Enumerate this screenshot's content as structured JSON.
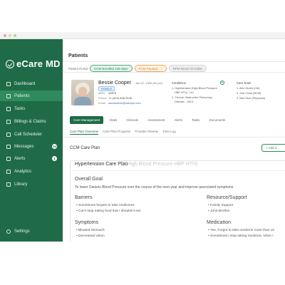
{
  "app": {
    "logo": "eCare MD",
    "colors": {
      "brand": "#1f6b47",
      "active_nav": "#2f8a5c"
    }
  },
  "sidebar": {
    "items": [
      {
        "label": "Dashboard",
        "icon": "grid-icon"
      },
      {
        "label": "Patients",
        "icon": "people-icon"
      },
      {
        "label": "Tasks",
        "icon": "checklist-icon"
      },
      {
        "label": "Billings & Claims",
        "icon": "dollar-icon"
      },
      {
        "label": "Call Scheduler",
        "icon": "phone-icon"
      },
      {
        "label": "Messages",
        "icon": "mail-icon",
        "badge": "14"
      },
      {
        "label": "Alerts",
        "icon": "bell-icon",
        "badge": "1"
      },
      {
        "label": "Analytics",
        "icon": "chart-icon"
      },
      {
        "label": "Library",
        "icon": "book-icon"
      }
    ],
    "settings": "Settings"
  },
  "header": {
    "title": "Patients"
  },
  "portal": {
    "label": "Patient Portal",
    "pills": [
      "CCM Enrolled 148 days",
      "PCM Paused",
      "RPM Never Enrolled"
    ],
    "pcm_badge": "!"
  },
  "patient": {
    "name": "Bessie Cooper",
    "meta": "Jan 02, 1956 (69 yrs)",
    "gender": "FEMALE",
    "fields": [
      {
        "key": "MRN",
        "value": "44875"
      },
      {
        "key": "Phone",
        "value": "+1 (423) 638-3126"
      },
      {
        "key": "Email",
        "value": "dannedeen@sample.com"
      }
    ],
    "conditions_title": "Conditions",
    "conditions": [
      "1. Hypertension (High Blood Pressure",
      "HBP HTN) - I10",
      "2. Chronic Obstructive Pulmonary",
      "Disease - J44.9"
    ],
    "care_team_title": "Care Team",
    "care_team": [
      "1. Alex Morris (CM)",
      "2. Jodi Cloud (BCM)",
      "3. Max Dion (Physician)"
    ]
  },
  "tabs": [
    "Care Management",
    "Vitals",
    "Clinicals",
    "Assessment",
    "Alerts",
    "Tasks",
    "Documents"
  ],
  "subtabs": [
    "Care Plan Overview",
    "Care Plan Progress",
    "Provider Review",
    "Time Log"
  ],
  "ccm": {
    "title": "CCM Care Plan",
    "add_button": "+ Add C"
  },
  "plan": {
    "title": "Hypertension Care Plan",
    "subtitle": "(High Blood Pressure HBP HTN)",
    "overall_goal_title": "Overall Goal",
    "overall_goal": "To lower Daniels Blood Pressure over the course of the next year and improve associated symptoms",
    "barriers_title": "Barriers",
    "barriers": [
      "Sometimes forgets to take medicines",
      "Can't stop eating food that I shouldn't eat"
    ],
    "resource_title": "Resource/Support",
    "resources": [
      "Family Support",
      "John-Brother"
    ],
    "symptoms_title": "Symptoms",
    "symptoms": [
      "Bloated Stomach",
      "Decreased vision"
    ],
    "medication_title": "Medication",
    "medications": [
      "Yes, Forgot to take medicine more than on",
      "Sometimes I stop taking medicine, when I"
    ]
  }
}
